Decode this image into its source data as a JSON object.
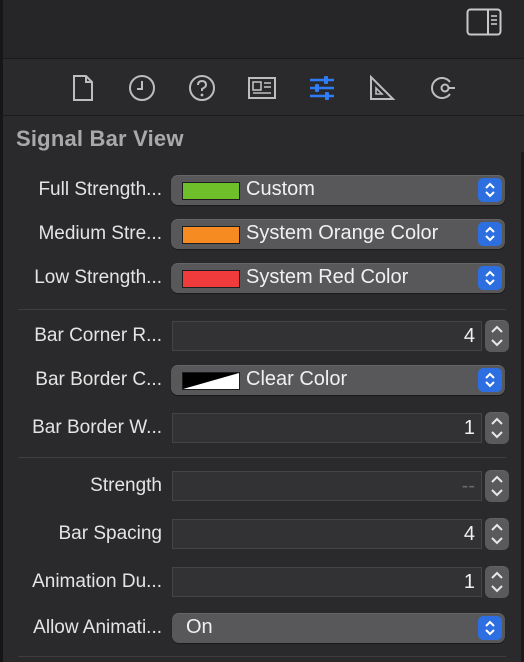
{
  "section": {
    "title": "Signal Bar View"
  },
  "tabs": [
    {
      "icon": "file-inspector-icon"
    },
    {
      "icon": "history-inspector-icon"
    },
    {
      "icon": "quick-help-icon"
    },
    {
      "icon": "identity-inspector-icon"
    },
    {
      "icon": "attributes-inspector-icon",
      "selected": true
    },
    {
      "icon": "size-inspector-icon"
    },
    {
      "icon": "connections-inspector-icon"
    }
  ],
  "colors": {
    "accent": "#2f7df6",
    "full_strength": "#6fbf2a",
    "medium_strength": "#f68b22",
    "low_strength": "#ef3b3b"
  },
  "rows": {
    "full_strength": {
      "label": "Full Strength...",
      "value": "Custom"
    },
    "medium_strength": {
      "label": "Medium Stre...",
      "value": "System Orange Color"
    },
    "low_strength": {
      "label": "Low Strength...",
      "value": "System Red Color"
    },
    "bar_corner_radius": {
      "label": "Bar Corner R...",
      "value": "4"
    },
    "bar_border_color": {
      "label": "Bar Border C...",
      "value": "Clear Color"
    },
    "bar_border_width": {
      "label": "Bar Border W...",
      "value": "1"
    },
    "strength": {
      "label": "Strength",
      "value": "--"
    },
    "bar_spacing": {
      "label": "Bar Spacing",
      "value": "4"
    },
    "animation_duration": {
      "label": "Animation Du...",
      "value": "1"
    },
    "allow_animation": {
      "label": "Allow Animati...",
      "value": "On"
    }
  }
}
